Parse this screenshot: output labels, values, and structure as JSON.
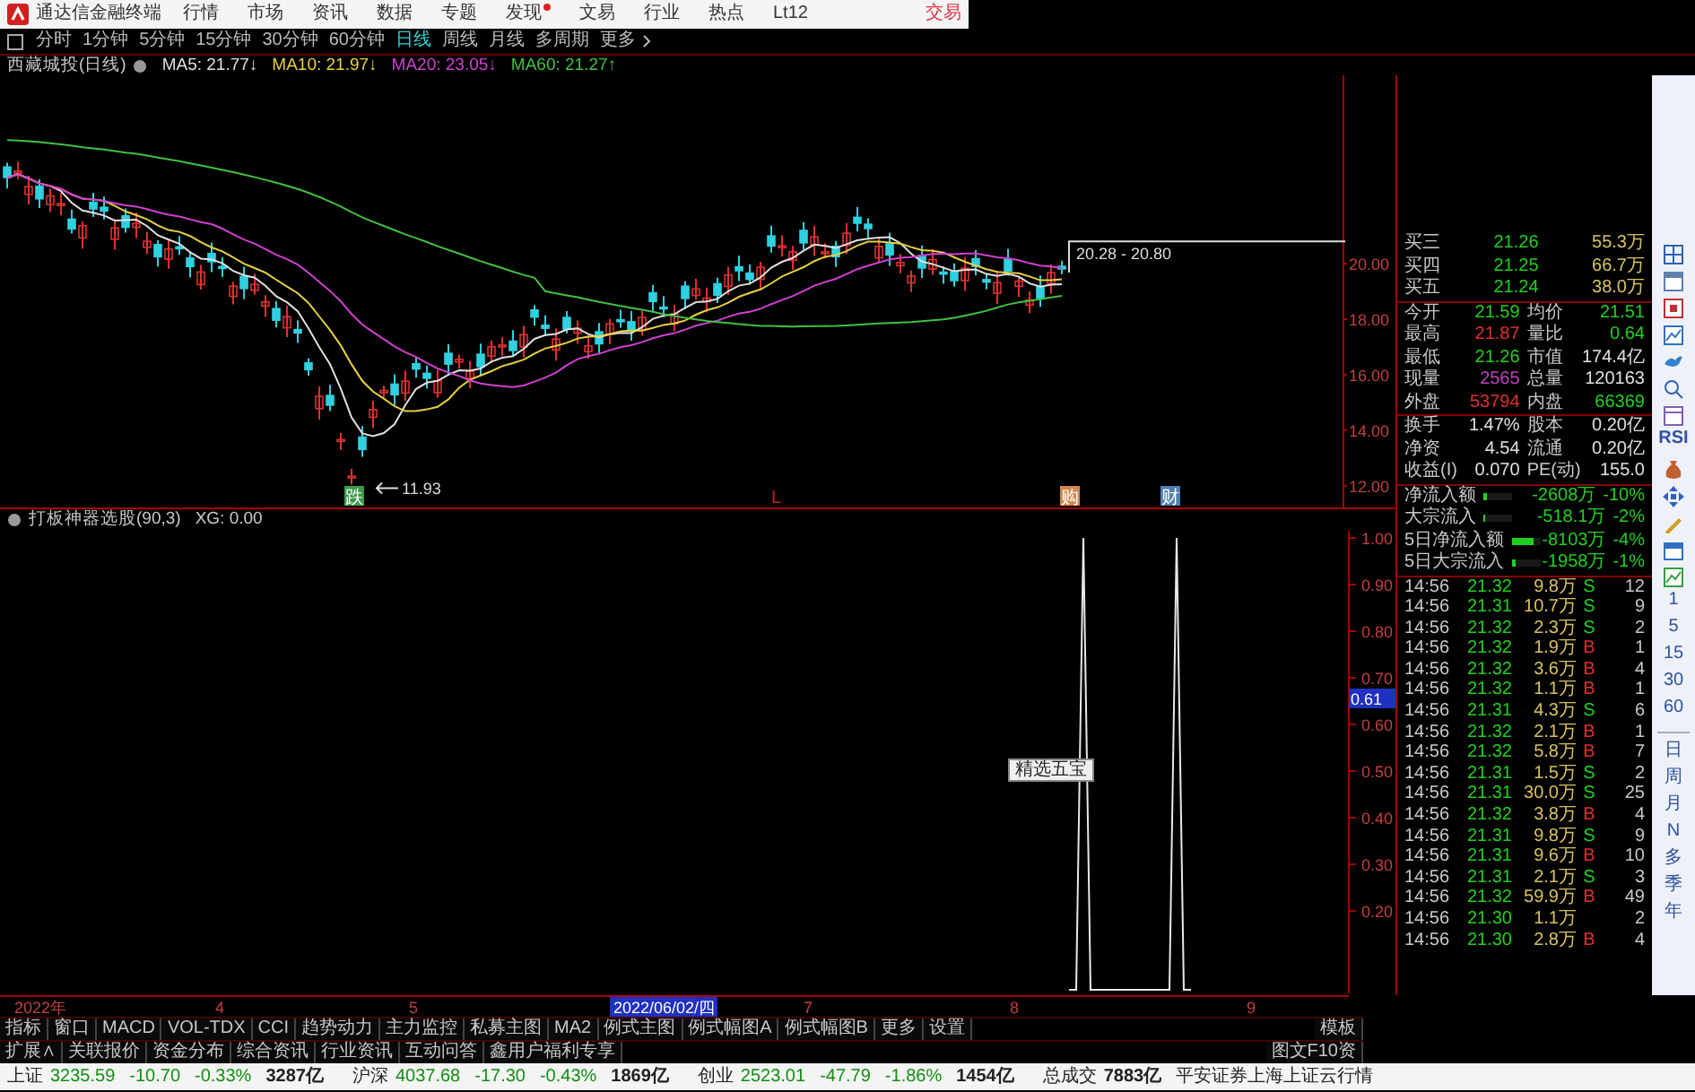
{
  "menu_bar": {
    "title": "通达信金融终端",
    "items": [
      {
        "label": "行情",
        "dot": false
      },
      {
        "label": "市场",
        "dot": false
      },
      {
        "label": "资讯",
        "dot": false
      },
      {
        "label": "数据",
        "dot": false
      },
      {
        "label": "专题",
        "dot": false
      },
      {
        "label": "发现",
        "dot": true
      },
      {
        "label": "文易",
        "dot": false
      },
      {
        "label": "行业",
        "dot": false
      },
      {
        "label": "热点",
        "dot": false
      },
      {
        "label": "Lt12",
        "dot": false
      }
    ],
    "trade": "交易"
  },
  "period_bar": {
    "items": [
      {
        "label": "分时",
        "selected": false
      },
      {
        "label": "1分钟",
        "selected": false
      },
      {
        "label": "5分钟",
        "selected": false
      },
      {
        "label": "15分钟",
        "selected": false
      },
      {
        "label": "30分钟",
        "selected": false
      },
      {
        "label": "60分钟",
        "selected": false
      },
      {
        "label": "日线",
        "selected": true
      },
      {
        "label": "周线",
        "selected": false
      },
      {
        "label": "月线",
        "selected": false
      },
      {
        "label": "多周期",
        "selected": false
      },
      {
        "label": "更多",
        "selected": false
      }
    ]
  },
  "ma_legend": {
    "title": "西藏城投(日线)",
    "items": [
      {
        "label": "MA5: 21.77↓",
        "color": "#e0e0e0"
      },
      {
        "label": "MA10: 21.97↓",
        "color": "#e8d040"
      },
      {
        "label": "MA20: 23.05↓",
        "color": "#d040d0"
      },
      {
        "label": "MA60: 21.27↑",
        "color": "#40c040"
      }
    ]
  },
  "main_chart": {
    "y_ticks": [
      "20.00",
      "18.00",
      "16.00",
      "14.00",
      "12.00"
    ],
    "low_label": "11.93",
    "range_label": "20.28 - 20.80",
    "markers": [
      {
        "label": "跌",
        "kind": "box",
        "color": "#3a9a4a"
      },
      {
        "label": "L",
        "kind": "text",
        "color": "#c02020"
      },
      {
        "label": "购",
        "kind": "box",
        "color": "#d08850"
      },
      {
        "label": "财",
        "kind": "box",
        "color": "#5080b0"
      }
    ]
  },
  "indicator": {
    "title": "打板神器选股(90,3)",
    "value_label": "XG: 0.00",
    "y_ticks": [
      "1.00",
      "0.90",
      "0.80",
      "0.70",
      "0.60",
      "0.50",
      "0.40",
      "0.30",
      "0.20"
    ],
    "cursor_value": "0.61",
    "tooltip": "精选五宝"
  },
  "x_axis": {
    "labels": [
      {
        "label": "2022年",
        "selected": false
      },
      {
        "label": "4",
        "selected": false
      },
      {
        "label": "5",
        "selected": false
      },
      {
        "label": "2022/06/02/四",
        "selected": true
      },
      {
        "label": "7",
        "selected": false
      },
      {
        "label": "8",
        "selected": false
      },
      {
        "label": "9",
        "selected": false
      }
    ]
  },
  "indicator_tabs": {
    "items": [
      "指标",
      "窗口",
      "MACD",
      "VOL-TDX",
      "CCI",
      "趋势动力",
      "主力监控",
      "私募主图",
      "MA2",
      "例式主图",
      "例式幅图A",
      "例式幅图B",
      "更多",
      "设置"
    ],
    "template": "模板"
  },
  "info_tabs": {
    "items": [
      "扩展∧",
      "关联报价",
      "资金分布",
      "综合资讯",
      "行业资讯",
      "互动问答",
      "鑫用户福利专享"
    ],
    "f10": "图文F10资"
  },
  "quote_panel": {
    "order_book": [
      {
        "label": "买三",
        "price": "21.26",
        "volume": "55.3万"
      },
      {
        "label": "买四",
        "price": "21.25",
        "volume": "66.7万"
      },
      {
        "label": "买五",
        "price": "21.24",
        "volume": "38.0万"
      }
    ],
    "stats": [
      [
        {
          "label": "今开",
          "value": "21.59",
          "color": "#20d020"
        },
        {
          "label": "均价",
          "value": "21.51",
          "color": "#20d020"
        }
      ],
      [
        {
          "label": "最高",
          "value": "21.87",
          "color": "#e03030"
        },
        {
          "label": "量比",
          "value": "0.64",
          "color": "#20d020"
        }
      ],
      [
        {
          "label": "最低",
          "value": "21.26",
          "color": "#20d020"
        },
        {
          "label": "市值",
          "value": "174.4亿",
          "color": "#e0e0e0"
        }
      ],
      [
        {
          "label": "现量",
          "value": "2565",
          "color": "#c040c0"
        },
        {
          "label": "总量",
          "value": "120163",
          "color": "#e0e0e0"
        }
      ],
      [
        {
          "label": "外盘",
          "value": "53794",
          "color": "#e03030"
        },
        {
          "label": "内盘",
          "value": "66369",
          "color": "#20d020"
        }
      ],
      [
        {
          "label": "换手",
          "value": "1.47%",
          "color": "#e0e0e0"
        },
        {
          "label": "股本",
          "value": "0.20亿",
          "color": "#e0e0e0"
        }
      ],
      [
        {
          "label": "净资",
          "value": "4.54",
          "color": "#e0e0e0"
        },
        {
          "label": "流通",
          "value": "0.20亿",
          "color": "#e0e0e0"
        }
      ],
      [
        {
          "label": "收益(I)",
          "value": "0.070",
          "color": "#e0e0e0"
        },
        {
          "label": "PE(动)",
          "value": "155.0",
          "color": "#e0e0e0"
        }
      ]
    ],
    "fund_flow": [
      {
        "label": "净流入额",
        "level": 0.15,
        "value": "-2608万",
        "share": "-10%"
      },
      {
        "label": "大宗流入",
        "level": 0.04,
        "value": "-518.1万",
        "share": "-2%"
      },
      {
        "label": "5日净流入额",
        "level": 0.8,
        "value": "-8103万",
        "share": "-4%"
      },
      {
        "label": "5日大宗流入",
        "level": 0.15,
        "value": "-1958万",
        "share": "-1%"
      }
    ],
    "trades": [
      {
        "time": "14:56",
        "price": "21.32",
        "volume": "9.8万",
        "side": "S",
        "kind": "sell",
        "count": "12"
      },
      {
        "time": "14:56",
        "price": "21.31",
        "volume": "10.7万",
        "side": "S",
        "kind": "sell",
        "count": "9"
      },
      {
        "time": "14:56",
        "price": "21.32",
        "volume": "2.3万",
        "side": "S",
        "kind": "sell",
        "count": "2"
      },
      {
        "time": "14:56",
        "price": "21.32",
        "volume": "1.9万",
        "side": "B",
        "kind": "buy",
        "count": "1"
      },
      {
        "time": "14:56",
        "price": "21.32",
        "volume": "3.6万",
        "side": "B",
        "kind": "buy",
        "count": "4"
      },
      {
        "time": "14:56",
        "price": "21.32",
        "volume": "1.1万",
        "side": "B",
        "kind": "buy",
        "count": "1"
      },
      {
        "time": "14:56",
        "price": "21.31",
        "volume": "4.3万",
        "side": "S",
        "kind": "sell",
        "count": "6"
      },
      {
        "time": "14:56",
        "price": "21.32",
        "volume": "2.1万",
        "side": "B",
        "kind": "buy",
        "count": "1"
      },
      {
        "time": "14:56",
        "price": "21.32",
        "volume": "5.8万",
        "side": "B",
        "kind": "buy",
        "count": "7"
      },
      {
        "time": "14:56",
        "price": "21.31",
        "volume": "1.5万",
        "side": "S",
        "kind": "sell",
        "count": "2"
      },
      {
        "time": "14:56",
        "price": "21.31",
        "volume": "30.0万",
        "side": "S",
        "kind": "sell",
        "count": "25"
      },
      {
        "time": "14:56",
        "price": "21.32",
        "volume": "3.8万",
        "side": "B",
        "kind": "buy",
        "count": "4"
      },
      {
        "time": "14:56",
        "price": "21.31",
        "volume": "9.8万",
        "side": "S",
        "kind": "sell",
        "count": "9"
      },
      {
        "time": "14:56",
        "price": "21.31",
        "volume": "9.6万",
        "side": "B",
        "kind": "buy",
        "count": "10"
      },
      {
        "time": "14:56",
        "price": "21.31",
        "volume": "2.1万",
        "side": "S",
        "kind": "sell",
        "count": "3"
      },
      {
        "time": "14:56",
        "price": "21.32",
        "volume": "59.9万",
        "side": "B",
        "kind": "buy",
        "count": "49"
      },
      {
        "time": "14:56",
        "price": "21.30",
        "volume": "1.1万",
        "count": "2"
      },
      {
        "time": "14:56",
        "price": "21.30",
        "volume": "2.8万",
        "side": "B",
        "kind": "buy",
        "count": "4"
      }
    ]
  },
  "side_toolbar": {
    "rsi": "RSI",
    "periods": [
      "1",
      "5",
      "15",
      "30",
      "60"
    ],
    "cycles": [
      "日",
      "周",
      "月",
      "N",
      "多",
      "季",
      "年"
    ]
  },
  "status_bar": {
    "indices": [
      {
        "name": "上证",
        "value": "3235.59",
        "change": "-10.70",
        "pct": "-0.33%",
        "amount": "3287亿"
      },
      {
        "name": "沪深",
        "value": "4037.68",
        "change": "-17.30",
        "pct": "-0.43%",
        "amount": "1869亿"
      },
      {
        "name": "创业",
        "value": "2523.01",
        "change": "-47.79",
        "pct": "-1.86%",
        "amount": "1454亿"
      }
    ],
    "total_label": "总成交",
    "total": "7883亿",
    "source": "平安证券上海上证云行情"
  }
}
